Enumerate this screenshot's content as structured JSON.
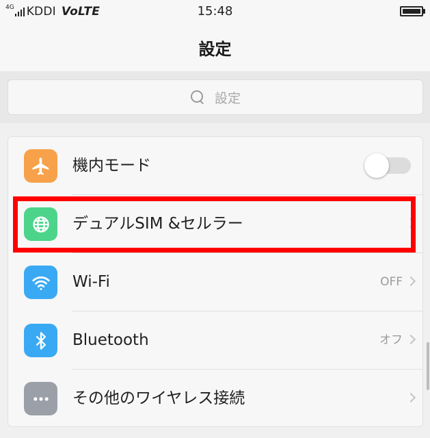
{
  "status_bar": {
    "network_type": "4G",
    "carrier": "KDDI",
    "volte": "VoLTE",
    "time": "15:48"
  },
  "header": {
    "title": "設定"
  },
  "search": {
    "placeholder": "設定"
  },
  "settings": [
    {
      "label": "機内モード",
      "icon": "airplane-icon",
      "icon_color": "#f7a24a",
      "control": "toggle",
      "toggle_on": false
    },
    {
      "label": "デュアルSIM &セルラー",
      "icon": "globe-icon",
      "icon_color": "#4cd48b",
      "control": "chevron",
      "highlighted": true
    },
    {
      "label": "Wi-Fi",
      "icon": "wifi-icon",
      "icon_color": "#3aa9f4",
      "control": "chevron",
      "value": "OFF"
    },
    {
      "label": "Bluetooth",
      "icon": "bluetooth-icon",
      "icon_color": "#3aa9f4",
      "control": "chevron",
      "value": "オフ"
    },
    {
      "label": "その他のワイヤレス接続",
      "icon": "more-icon",
      "icon_color": "#9b9fa8",
      "control": "chevron"
    }
  ],
  "highlight_color": "#ff0000"
}
